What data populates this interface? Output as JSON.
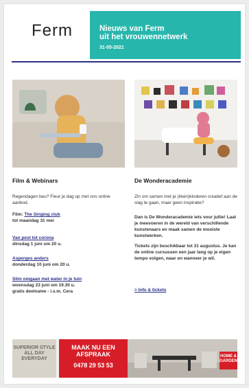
{
  "header": {
    "logo": "Ferm",
    "title_line1": "Nieuws van Ferm",
    "title_line2": "uit het vrouwennetwerk",
    "date": "31-05-2021"
  },
  "left_column": {
    "title": "Film & Webinars",
    "intro": "Regendagen beu? Fleur je dag op met ons online aanbod.",
    "items": [
      {
        "prefix": "Film:",
        "link": "The Singing club",
        "detail": "tot maandag 31 mei"
      },
      {
        "link": "Van pest tot corona",
        "detail": "dinsdag 1 juni om 20 u."
      },
      {
        "link": "Asperges anders",
        "detail": "donderdag 10 juni om 20 u."
      },
      {
        "link": "Slim omgaan met water in je tuin",
        "detail": "woensdag 23 juni om 19.30 u.",
        "extra": "gratis deelname - i.s.m. Cera"
      }
    ]
  },
  "right_column": {
    "title": "De Wonderacademie",
    "p1": "Zin om samen met je (klein)kinderen creatief aan de slag te gaan, maar geen inspiratie?",
    "p2": "Dan is De Wonderacademie iets voor jullie! Laat je meevoeren in de wereld van verschillende kunstenaars en maak samen de mooiste kunstwerken.",
    "p3": "Tickets zijn beschikbaar tot 31 augustus. Je kan de online cursussen een jaar lang op je eigen tempo volgen, waar en wanneer je wil.",
    "link": "> Info & tickets"
  },
  "banner": {
    "left_text": "SUPERIOR STYLE ALL DAY EVERYDAY",
    "cta": "MAAK NU EEN AFSPRAAK",
    "phone": "0478 29 53 53",
    "badge": "HOME & GARDEN"
  },
  "colors": {
    "teal": "#27b6ac",
    "navy_rule": "#2b2f86",
    "banner_red": "#d71e28"
  }
}
